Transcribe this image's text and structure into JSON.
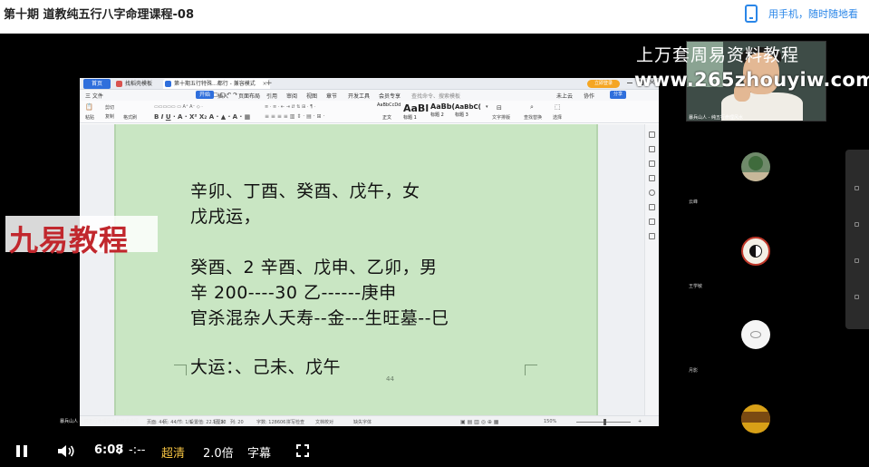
{
  "header": {
    "course_title": "第十期 道教纯五行八字命理课程-08",
    "mobile_link": "用手机，随时随地看"
  },
  "wps": {
    "tabs": {
      "home": "首页",
      "tab1": "找稻壳模板",
      "tab2": "第十期五行特殊...都行 - 兼容模式"
    },
    "login_label": "立即登录",
    "menu": [
      "三 文件",
      "开始",
      "插入",
      "页面布局",
      "引用",
      "审阅",
      "视图",
      "章节",
      "开发工具",
      "会员专享",
      "查找命令、搜索模板"
    ],
    "share_label": "分享",
    "menu_right": [
      "未上云",
      "协作"
    ],
    "ribbon_left": [
      "格式刷",
      "粘贴",
      "剪切",
      "复制"
    ],
    "styles": [
      {
        "preview": "AaBbCcDd",
        "name": "正文"
      },
      {
        "preview": "AaBl",
        "name": "标题 1"
      },
      {
        "preview": "AaBb(",
        "name": "标题 2"
      },
      {
        "preview": "AaBbC(",
        "name": "标题 3"
      }
    ],
    "ribbon_right": [
      "文字排版",
      "查找替换",
      "选择"
    ],
    "page_number": "44",
    "status": [
      "页面: 44",
      "页: 44/",
      "节: 1/1",
      "设置值: 22.1厘米",
      "行: 22",
      "列: 20",
      "字数: 128606",
      "拼写检查",
      "文档校对",
      "缺失字体"
    ],
    "zoom": "150%"
  },
  "document": {
    "lines": [
      "辛卯、丁酉、癸酉、戊午，女",
      "戊戌运，",
      "癸酉、2 辛酉、戊申、乙卯，男",
      "辛 200----30 乙------庚申",
      "官杀混杂人夭寿--金---生旺墓--巳",
      "大运：、己未、戊午"
    ]
  },
  "watermark": {
    "brand": "九易教程",
    "title": "上万套周易资料教程",
    "url": "www.265zhouyiw.com"
  },
  "camera": {
    "caption": "暴兵山人 - 纯五行命理风水"
  },
  "participants": [
    {
      "name": "云峰"
    },
    {
      "name": "王学敏"
    },
    {
      "name": "月影"
    },
    {
      "name": "无名"
    }
  ],
  "taskbar_caption": "暴兵山人 -- 纯五行命理风水的开发课程",
  "player": {
    "time_current": "6:08",
    "time_sep": "/",
    "time_total": "-:--",
    "quality": "超清",
    "speed": "2.0倍",
    "subtitles": "字幕"
  },
  "colors": {
    "quality_accent": "#f5c342",
    "link_blue": "#2a86e8",
    "page_green": "#c9e6c3",
    "brand_red": "#c1272d"
  }
}
